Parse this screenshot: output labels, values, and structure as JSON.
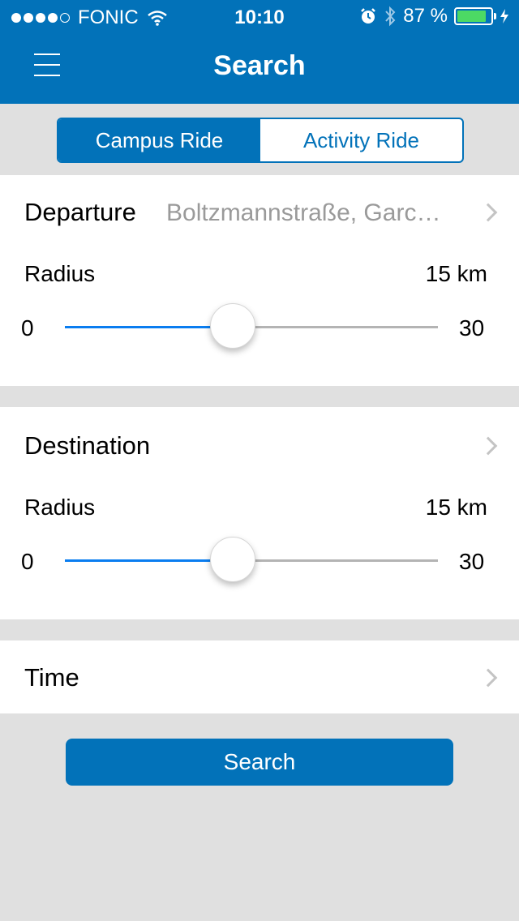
{
  "status_bar": {
    "carrier": "FONIC",
    "time": "10:10",
    "battery_percent": "87 %",
    "battery_level": 0.87,
    "signal_bars": 4,
    "signal_total": 5
  },
  "nav": {
    "title": "Search",
    "menu_icon": "hamburger-menu-icon"
  },
  "segmented": {
    "options": [
      "Campus Ride",
      "Activity Ride"
    ],
    "selected": "Campus Ride"
  },
  "departure": {
    "label": "Departure",
    "value": "Boltzmannstraße, Garc…",
    "radius_label": "Radius",
    "radius_value": "15 km",
    "min": "0",
    "max": "30",
    "slider_value": 15,
    "slider_min": 0,
    "slider_max": 30
  },
  "destination": {
    "label": "Destination",
    "value": "",
    "radius_label": "Radius",
    "radius_value": "15 km",
    "min": "0",
    "max": "30",
    "slider_value": 15,
    "slider_min": 0,
    "slider_max": 30
  },
  "time": {
    "label": "Time"
  },
  "search_button": {
    "label": "Search"
  },
  "colors": {
    "primary": "#0272b9",
    "slider_active": "#0a7df0",
    "background": "#e0e0e0",
    "battery": "#4cd964"
  }
}
